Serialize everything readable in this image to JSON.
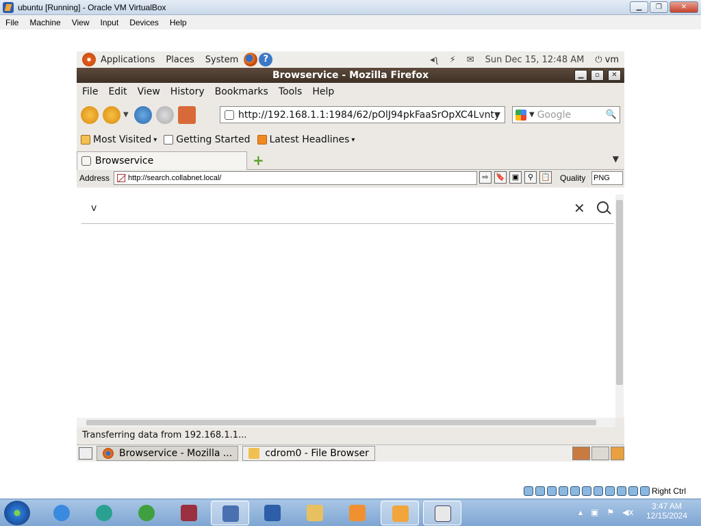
{
  "host": {
    "title": "ubuntu [Running] - Oracle VM VirtualBox",
    "menu": [
      "File",
      "Machine",
      "View",
      "Input",
      "Devices",
      "Help"
    ],
    "tray_text": "Right Ctrl",
    "clock_time": "3:47 AM",
    "clock_date": "12/15/2024"
  },
  "gnome": {
    "menu": [
      "Applications",
      "Places",
      "System"
    ],
    "datetime": "Sun Dec 15, 12:48 AM",
    "user": "vm"
  },
  "firefox": {
    "title": "Browservice - Mozilla Firefox",
    "menu": [
      "File",
      "Edit",
      "View",
      "History",
      "Bookmarks",
      "Tools",
      "Help"
    ],
    "url": "http://192.168.1.1:1984/62/pOlJ94pkFaaSrOpXC4Lvnty",
    "search_placeholder": "Google",
    "bookmarks": [
      "Most Visited",
      "Getting Started",
      "Latest Headlines"
    ],
    "tab_label": "Browservice",
    "status": "Transferring data from 192.168.1.1..."
  },
  "browservice": {
    "address_label": "Address",
    "address_value": "http://search.collabnet.local/",
    "quality_label": "Quality",
    "quality_value": "PNG",
    "search_query": "v"
  },
  "guest_taskbar": {
    "items": [
      "Browservice - Mozilla ...",
      "cdrom0 - File Browser"
    ]
  }
}
